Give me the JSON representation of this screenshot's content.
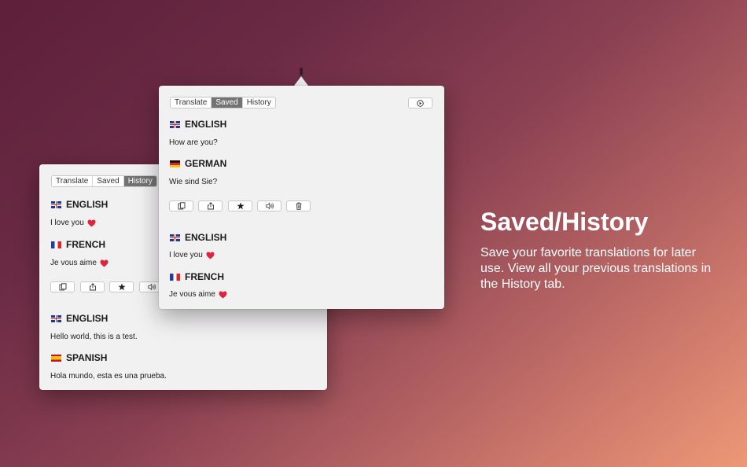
{
  "hero": {
    "headline": "Saved/History",
    "subtext": "Save your favorite translations for later use. View all your previous translations in the History tab."
  },
  "back_panel": {
    "tabs": [
      "Translate",
      "Saved",
      "History"
    ],
    "active_tab": "History",
    "entries": [
      {
        "source_lang": "ENGLISH",
        "source_text": "I love you",
        "target_lang": "FRENCH",
        "target_text": "Je vous aime"
      },
      {
        "source_lang": "ENGLISH",
        "source_text": "Hello world, this is a test.",
        "target_lang": "SPANISH",
        "target_text": "Hola mundo, esta es una prueba."
      }
    ]
  },
  "front_panel": {
    "tabs": [
      "Translate",
      "Saved",
      "History"
    ],
    "active_tab": "Saved",
    "entries": [
      {
        "source_lang": "ENGLISH",
        "source_text": "How are you?",
        "target_lang": "GERMAN",
        "target_text": "Wie sind Sie?"
      },
      {
        "source_lang": "ENGLISH",
        "source_text": "I love you",
        "target_lang": "FRENCH",
        "target_text": "Je vous aime"
      }
    ]
  },
  "icons": {
    "copy": "copy-icon",
    "share": "share-icon",
    "favorite": "star-icon",
    "speak": "speaker-icon",
    "delete": "trash-icon",
    "settings": "play-circle-icon",
    "heart": "heart-icon"
  },
  "colors": {
    "active_tab": "#737373",
    "heart": "#e0243b",
    "panel_bg": "#f2f1f2"
  }
}
